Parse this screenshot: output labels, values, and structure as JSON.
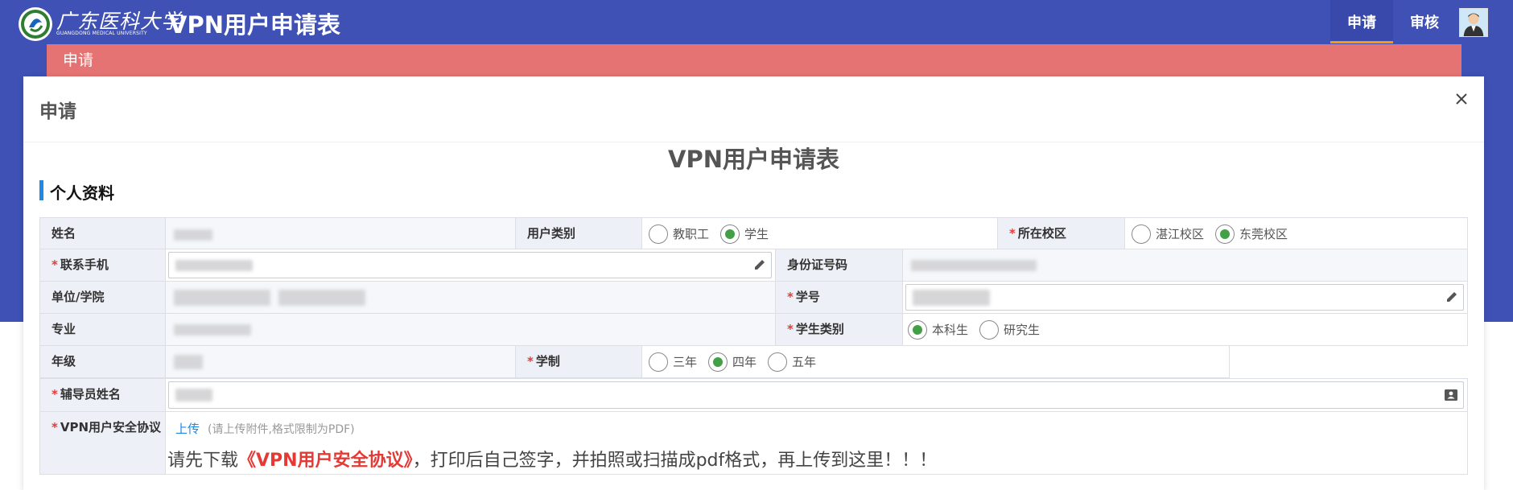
{
  "header": {
    "school_name_cn": "广东医科大学",
    "school_name_en": "GUANGDONG MEDICAL UNIVERSITY",
    "app_title": "VPN用户申请表",
    "tabs": [
      {
        "label": "申请",
        "active": true
      },
      {
        "label": "审核",
        "active": false
      }
    ]
  },
  "strip": {
    "label": "申请"
  },
  "dialog": {
    "title": "申请",
    "form_title": "VPN用户申请表",
    "section": "个人资料"
  },
  "form": {
    "name_label": "姓名",
    "user_type_label": "用户类别",
    "user_type_options": [
      {
        "label": "教职工",
        "checked": false
      },
      {
        "label": "学生",
        "checked": true
      }
    ],
    "campus_label": "所在校区",
    "campus_options": [
      {
        "label": "湛江校区",
        "checked": false
      },
      {
        "label": "东莞校区",
        "checked": true
      }
    ],
    "phone_label": "联系手机",
    "id_label": "身份证号码",
    "unit_label": "单位/学院",
    "student_no_label": "学号",
    "major_label": "专业",
    "student_type_label": "学生类别",
    "student_type_options": [
      {
        "label": "本科生",
        "checked": true
      },
      {
        "label": "研究生",
        "checked": false
      }
    ],
    "grade_label": "年级",
    "duration_label": "学制",
    "duration_options": [
      {
        "label": "三年",
        "checked": false
      },
      {
        "label": "四年",
        "checked": true
      },
      {
        "label": "五年",
        "checked": false
      }
    ],
    "counselor_label": "辅导员姓名",
    "agreement_label": "VPN用户安全协议",
    "upload_label": "上传",
    "upload_hint": "(请上传附件,格式限制为PDF)",
    "notice_prefix": "请先下载",
    "notice_link": "《VPN用户安全协议》",
    "notice_suffix": "，打印后自己签字，并拍照或扫描成pdf格式，再上传到这里！！！"
  },
  "colors": {
    "header": "#3f51b5",
    "strip": "#e57373",
    "accent": "#1e88e5",
    "required": "#e53935",
    "radio_checked": "#43a047"
  },
  "icons": [
    "close-icon",
    "pencil-icon",
    "contact-card-icon",
    "school-logo"
  ]
}
